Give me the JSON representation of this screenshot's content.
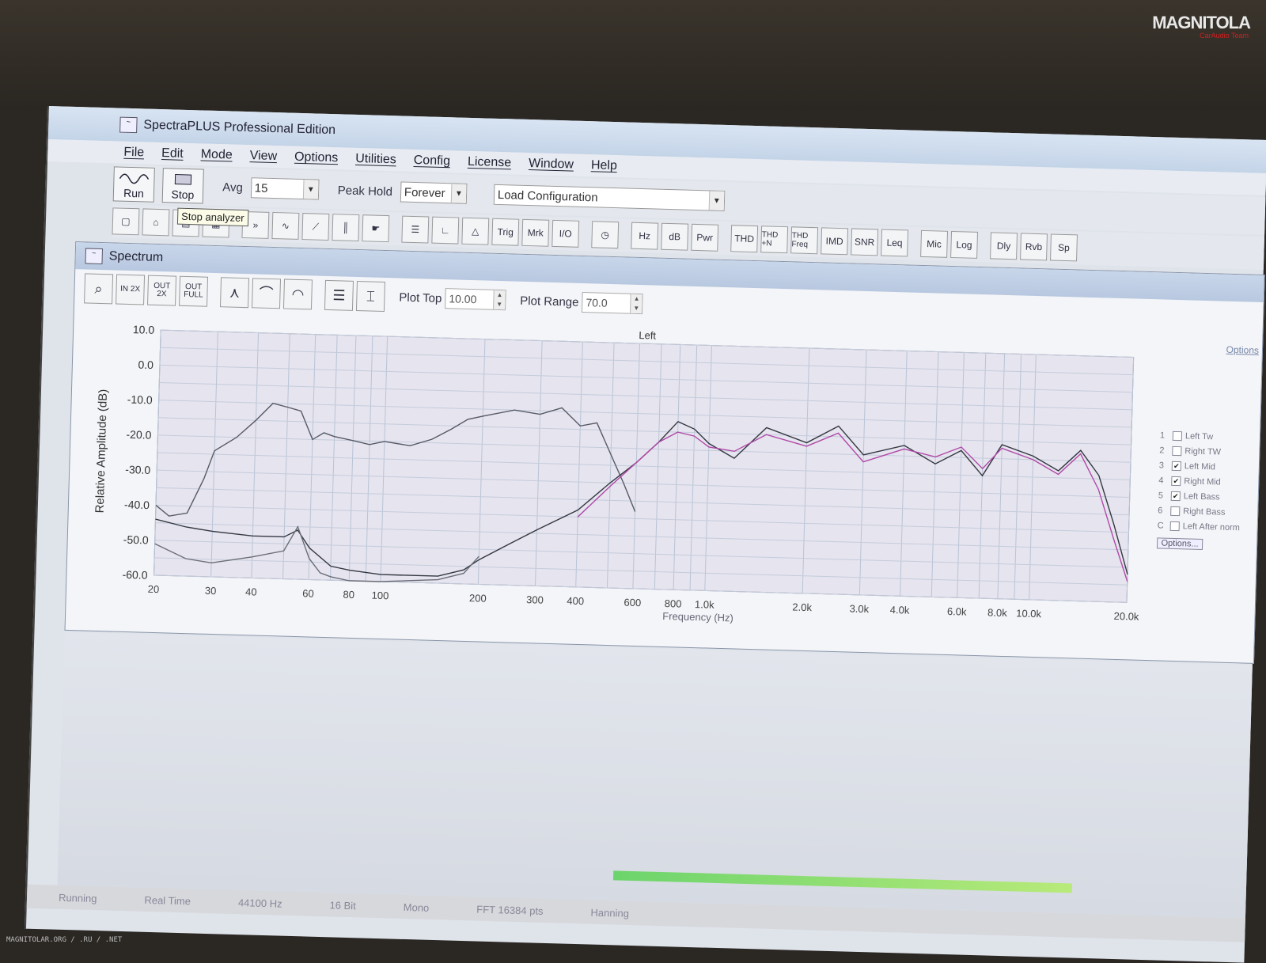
{
  "photo": {
    "logo_text": "MAGNITOLA",
    "logo_sub": "CarAudio Team",
    "watermark": "MAGNITOLAR.ORG / .RU / .NET"
  },
  "window": {
    "title": "SpectraPLUS Professional Edition",
    "icon": "spectraplus-app-icon"
  },
  "menu": [
    "File",
    "Edit",
    "Mode",
    "View",
    "Options",
    "Utilities",
    "Config",
    "License",
    "Window",
    "Help"
  ],
  "toolbar": {
    "run_label": "Run",
    "stop_label": "Stop",
    "stop_tooltip": "Stop analyzer",
    "avg_label": "Avg",
    "avg_value": "15",
    "peak_hold_label": "Peak Hold",
    "peak_hold_value": "Forever",
    "load_config_value": "Load Configuration"
  },
  "toolbar2": {
    "buttons_a": [
      "new-icon",
      "open-icon",
      "save-icon",
      "print-icon"
    ],
    "buttons_b": [
      "forward-icon",
      "curve-icon",
      "slope-icon",
      "bars-icon",
      "hand-icon"
    ],
    "buttons_c": [
      "list-icon",
      "axis-icon",
      "triangle-icon"
    ],
    "text_buttons_1": [
      "Trig",
      "Mrk",
      "I/O"
    ],
    "text_buttons_2": [
      "Hz",
      "dB",
      "Pwr"
    ],
    "text_buttons_3": [
      "THD",
      "THD +N",
      "THD Freq",
      "IMD",
      "SNR",
      "Leq"
    ],
    "text_buttons_4": [
      "Mic",
      "Log"
    ],
    "text_buttons_5": [
      "Dly",
      "Rvb",
      "Sp"
    ]
  },
  "spectrum": {
    "title": "Spectrum",
    "zoom_buttons": [
      "magnify-icon",
      "IN 2X",
      "OUT 2X",
      "OUT FULL"
    ],
    "plot_top_label": "Plot Top",
    "plot_top_value": "10.00",
    "plot_range_label": "Plot Range",
    "plot_range_value": "70.0",
    "options_link": "Options"
  },
  "legend": {
    "items": [
      {
        "num": "1",
        "label": "Left Tw",
        "checked": false
      },
      {
        "num": "2",
        "label": "Right TW",
        "checked": false
      },
      {
        "num": "3",
        "label": "Left Mid",
        "checked": true
      },
      {
        "num": "4",
        "label": "Right Mid",
        "checked": true
      },
      {
        "num": "5",
        "label": "Left Bass",
        "checked": true
      },
      {
        "num": "6",
        "label": "Right Bass",
        "checked": false
      },
      {
        "num": "C",
        "label": "Left After norm",
        "checked": false
      }
    ],
    "options_button": "Options..."
  },
  "status": {
    "state": "Running",
    "mode": "Real Time",
    "rate": "44100 Hz",
    "bits": "16 Bit",
    "channels": "Mono",
    "fft": "FFT 16384 pts",
    "window": "Hanning"
  },
  "chart_data": {
    "type": "line",
    "title": "Left",
    "xlabel": "Frequency (Hz)",
    "ylabel": "Relative Amplitude (dB)",
    "x_scale": "log",
    "xlim": [
      20,
      20000
    ],
    "ylim": [
      -60,
      10
    ],
    "yticks": [
      10,
      0,
      -10,
      -20,
      -30,
      -40,
      -50,
      -60
    ],
    "ytick_labels": [
      "10.0",
      "0.0",
      "-10.0",
      "-20.0",
      "-30.0",
      "-40.0",
      "-50.0",
      "-60.0"
    ],
    "xticks": [
      20,
      30,
      40,
      60,
      80,
      100,
      200,
      300,
      400,
      600,
      800,
      1000,
      2000,
      3000,
      4000,
      6000,
      8000,
      10000,
      20000
    ],
    "xtick_labels": [
      "20",
      "30",
      "40",
      "60",
      "80",
      "100",
      "200",
      "300",
      "400",
      "600",
      "800",
      "1.0k",
      "2.0k",
      "3.0k",
      "4.0k",
      "6.0k",
      "8.0k",
      "10.0k",
      "20.0k"
    ],
    "grid": true,
    "series": [
      {
        "name": "Left Bass",
        "color": "#555a66",
        "x": [
          20,
          22,
          25,
          28,
          30,
          35,
          40,
          45,
          50,
          55,
          60,
          65,
          70,
          80,
          90,
          100,
          120,
          140,
          160,
          180,
          200,
          250,
          300,
          350,
          400,
          450,
          500,
          550,
          600
        ],
        "y": [
          -40,
          -43,
          -42,
          -32,
          -24,
          -20,
          -15,
          -10,
          -11,
          -12,
          -20,
          -18,
          -19,
          -20,
          -21,
          -20,
          -21,
          -19,
          -16,
          -13,
          -12,
          -10,
          -11,
          -9,
          -14,
          -13,
          -22,
          -30,
          -38
        ]
      },
      {
        "name": "Left Mid",
        "color": "#333842",
        "x": [
          20,
          25,
          30,
          40,
          50,
          55,
          60,
          70,
          80,
          100,
          150,
          180,
          200,
          250,
          300,
          400,
          500,
          600,
          700,
          800,
          900,
          1000,
          1200,
          1500,
          2000,
          2500,
          3000,
          4000,
          5000,
          6000,
          7000,
          8000,
          10000,
          12000,
          14000,
          16000,
          18000,
          20000
        ],
        "y": [
          -44,
          -46,
          -47,
          -48,
          -48,
          -46,
          -51,
          -56,
          -57,
          -58,
          -58,
          -56,
          -53,
          -48,
          -44,
          -38,
          -30,
          -24,
          -18,
          -12,
          -14,
          -18,
          -22,
          -13,
          -17,
          -12,
          -20,
          -17,
          -22,
          -18,
          -25,
          -16,
          -19,
          -23,
          -17,
          -24,
          -38,
          -52
        ]
      },
      {
        "name": "Right Mid",
        "color": "#b04aa8",
        "x": [
          400,
          500,
          600,
          700,
          800,
          900,
          1000,
          1200,
          1500,
          2000,
          2500,
          3000,
          4000,
          5000,
          6000,
          7000,
          8000,
          10000,
          12000,
          14000,
          16000,
          18000,
          20000
        ],
        "y": [
          -40,
          -31,
          -24,
          -18,
          -15,
          -16,
          -19,
          -20,
          -15,
          -18,
          -14,
          -22,
          -18,
          -20,
          -17,
          -23,
          -17,
          -20,
          -24,
          -18,
          -28,
          -42,
          -54
        ]
      },
      {
        "name": "Left Bass (2)",
        "color": "#6a6e78",
        "x": [
          20,
          25,
          30,
          40,
          50,
          55,
          60,
          65,
          70,
          80,
          100,
          150,
          180,
          200
        ],
        "y": [
          -51,
          -55,
          -56,
          -54,
          -52,
          -45,
          -54,
          -58,
          -59,
          -60,
          -60,
          -59,
          -57,
          -52
        ]
      }
    ]
  }
}
